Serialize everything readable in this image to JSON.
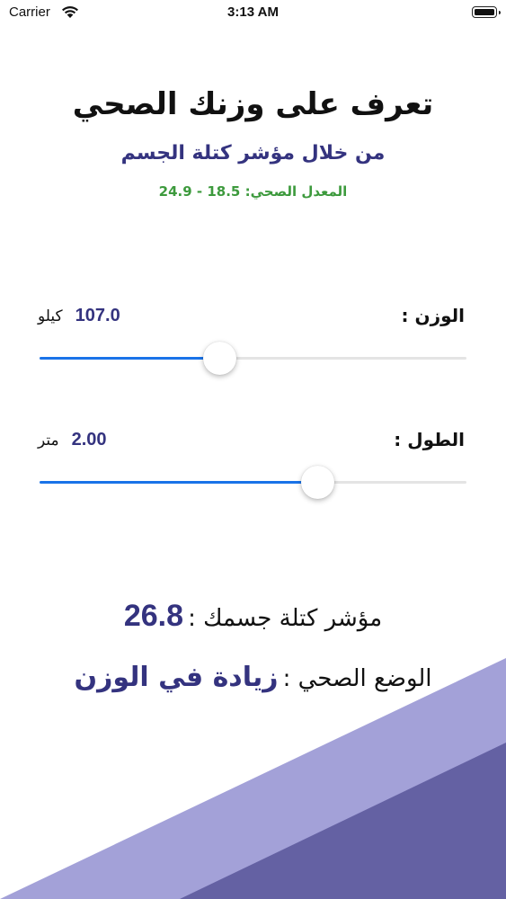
{
  "status_bar": {
    "carrier": "Carrier",
    "time": "3:13 AM"
  },
  "header": {
    "title": "تعرف على وزنك الصحي",
    "subtitle": "من خلال مؤشر كتلة الجسم",
    "healthy_range": "المعدل الصحي: 18.5 - 24.9"
  },
  "weight": {
    "label": "الوزن :",
    "value": "107.0",
    "unit": "كيلو",
    "slider_fraction": 0.42
  },
  "height": {
    "label": "الطول :",
    "value": "2.00",
    "unit": "متر",
    "slider_fraction": 0.65
  },
  "result": {
    "bmi_label": "مؤشر كتلة جسمك :",
    "bmi_value": "26.8",
    "status_label": "الوضع الصحي :",
    "status_value": "زيادة في الوزن"
  },
  "colors": {
    "accent": "#34337f",
    "healthy_green": "#3d9a3d",
    "slider_fill": "#1a73e8",
    "shape_light": "#a3a1d8",
    "shape_dark": "#6461a3"
  }
}
